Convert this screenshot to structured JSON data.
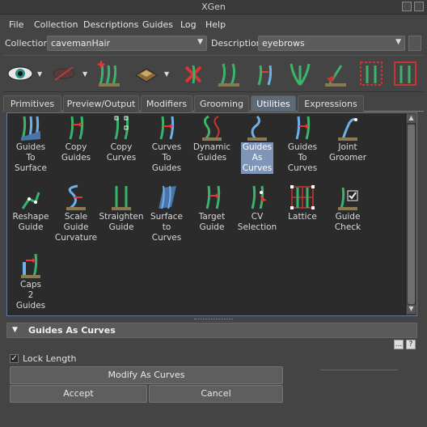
{
  "window": {
    "title": "XGen"
  },
  "menubar": {
    "items": [
      "File",
      "Collection",
      "Descriptions",
      "Guides",
      "Log",
      "Help"
    ]
  },
  "selectors": {
    "collection_label": "Collection",
    "collection_value": "cavemanHair",
    "description_label": "Description",
    "description_value": "eyebrows"
  },
  "toolbar": {
    "icons": [
      "visibility-eye-icon",
      "hidden-primitives-icon",
      "add-guides-icon",
      "select-patches-icon",
      "delete-guide-icon",
      "guide-edit-icon",
      "guide-rebuild-icon",
      "guide-fan-icon",
      "guide-flip-icon",
      "guide-cv-icon",
      "guide-lattice-icon"
    ]
  },
  "tabs": [
    "Primitives",
    "Preview/Output",
    "Modifiers",
    "Grooming",
    "Utilities",
    "Expressions"
  ],
  "active_tab": "Utilities",
  "utilities": [
    {
      "label": "Guides\nTo\nSurface",
      "icon": "guides-to-surface-icon"
    },
    {
      "label": "Copy\nGuides",
      "icon": "copy-guides-icon"
    },
    {
      "label": "Copy\nCurves",
      "icon": "copy-curves-icon"
    },
    {
      "label": "Curves\nTo\nGuides",
      "icon": "curves-to-guides-icon"
    },
    {
      "label": "Dynamic\nGuides",
      "icon": "dynamic-guides-icon"
    },
    {
      "label": "Guides\nAs\nCurves",
      "icon": "guides-as-curves-icon",
      "selected": true
    },
    {
      "label": "Guides\nTo\nCurves",
      "icon": "guides-to-curves-icon"
    },
    {
      "label": "Joint\nGroomer",
      "icon": "joint-groomer-icon"
    },
    {
      "label": "Reshape\nGuide",
      "icon": "reshape-guide-icon"
    },
    {
      "label": "Scale\nGuide\nCurvature",
      "icon": "scale-guide-curvature-icon"
    },
    {
      "label": "Straighten\nGuide",
      "icon": "straighten-guide-icon"
    },
    {
      "label": "Surface\nto\nCurves",
      "icon": "surface-to-curves-icon"
    },
    {
      "label": "Target\nGuide",
      "icon": "target-guide-icon"
    },
    {
      "label": "CV\nSelection",
      "icon": "cv-selection-icon"
    },
    {
      "label": "Lattice",
      "icon": "lattice-icon"
    },
    {
      "label": "Guide\nCheck",
      "icon": "guide-check-icon"
    },
    {
      "label": "Caps\n2\nGuides",
      "icon": "caps-2-guides-icon"
    }
  ],
  "section": {
    "title": "Guides As Curves",
    "lock_length_label": "Lock Length",
    "lock_length_checked": true,
    "modify_button": "Modify As Curves",
    "accept_button": "Accept",
    "cancel_button": "Cancel",
    "mini_buttons": [
      "...",
      "?"
    ]
  },
  "colors": {
    "accent": "#5b7aa0",
    "selected": "#7e95b8",
    "guide_green": "#3bb36b"
  }
}
